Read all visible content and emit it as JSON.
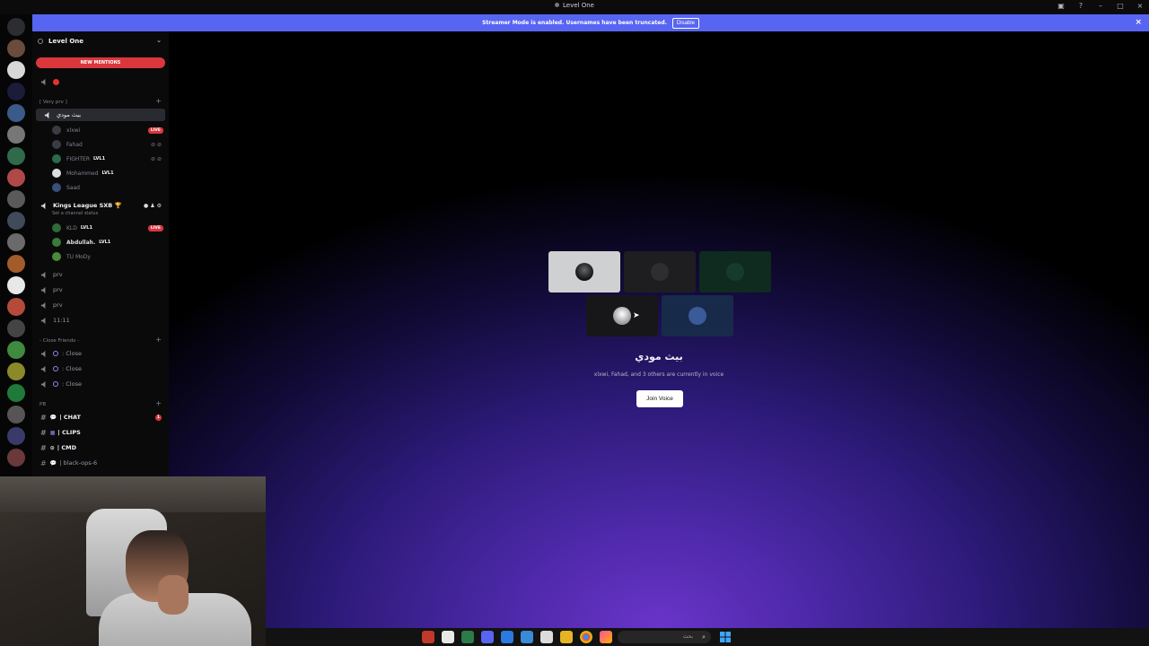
{
  "window": {
    "title": "Level One"
  },
  "banner": {
    "text": "Streamer Mode is enabled. Usernames have been truncated.",
    "disable_label": "Disable",
    "close_glyph": "×"
  },
  "guild": {
    "name": "Level One",
    "new_mentions_label": "NEW MENTIONS"
  },
  "channels": {
    "category_very_prv": "[ Very prv ]",
    "selected_voice": "بيث مودي",
    "voice_members": [
      {
        "name": "xlxwi",
        "badge": "",
        "live": "LIVE"
      },
      {
        "name": "Fahad",
        "badge": "",
        "live": ""
      },
      {
        "name": "FIGHTER",
        "badge": "LVL1",
        "live": ""
      },
      {
        "name": "Mohammed",
        "badge": "LVL1",
        "live": ""
      },
      {
        "name": "Saad",
        "badge": "",
        "live": ""
      }
    ],
    "kings_league": "Kings League SXB 🏆",
    "kings_status": "Set a channel status",
    "kings_members": [
      {
        "name": "KLD",
        "badge": "LVL1",
        "live": "LIVE"
      },
      {
        "name": "Abdullah.",
        "badge": "LVL1",
        "live": ""
      },
      {
        "name": "TU MoDy",
        "badge": "",
        "live": ""
      }
    ],
    "prv_rooms": [
      "prv",
      "prv",
      "prv",
      "11:11"
    ],
    "category_close": "- Close Friends -",
    "close_rooms": [
      ": Close",
      ": Close",
      ": Close"
    ],
    "category_pb": "PB",
    "text_channels": [
      {
        "name": "| CHAT",
        "badge": "1",
        "bold": true
      },
      {
        "name": "| CLIPS",
        "badge": "",
        "bold": true
      },
      {
        "name": "| CMD",
        "badge": "",
        "bold": true
      },
      {
        "name": "| black-ops-6",
        "badge": "",
        "bold": false
      }
    ]
  },
  "voice_view": {
    "title": "بيث مودي",
    "subtitle": "xlxwi, Fahad, and 3 others are currently in voice",
    "join_label": "Join Voice"
  },
  "taskbar": {
    "search_placeholder": "بحث"
  },
  "colors": {
    "accent": "#5865f2",
    "danger": "#da373c",
    "main_glow": "#6a34c9"
  }
}
